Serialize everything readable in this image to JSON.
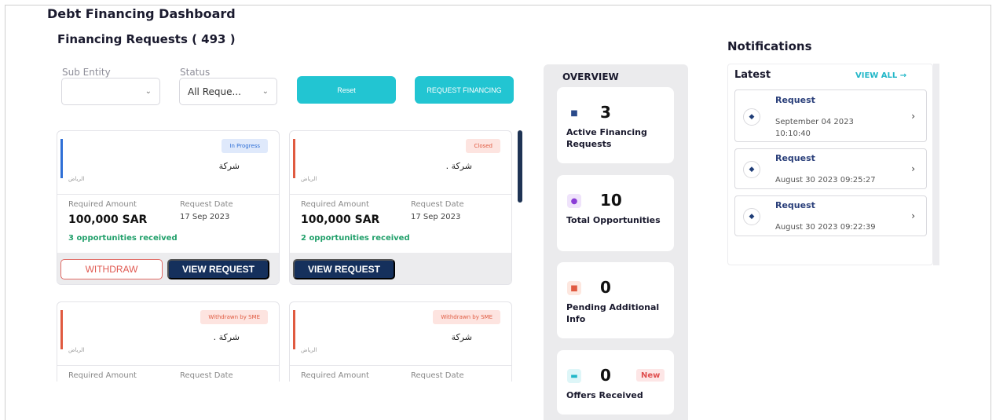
{
  "page_title": "Debt Financing Dashboard",
  "section_title": "Financing Requests ( 493 )",
  "filters": {
    "sub_entity_label": "Sub Entity",
    "sub_entity_value": "",
    "status_label": "Status",
    "status_value": "All Reque...",
    "reset_label": "Reset",
    "request_financing_label": "REQUEST FINANCING"
  },
  "common": {
    "required_amount_label": "Required Amount",
    "request_date_label": "Request Date",
    "withdraw_label": "WITHDRAW",
    "view_request_label": "VIEW REQUEST"
  },
  "cards": [
    {
      "status": "In Progress",
      "status_color": "#2f6fd6",
      "company": "شركة",
      "city": "الرياض",
      "amount": "100,000 SAR",
      "date": "17 Sep 2023",
      "opportunities": "3 opportunities received"
    },
    {
      "status": "Closed",
      "status_color": "#e05a40",
      "company": "شركة .",
      "city": "الرياض",
      "amount": "100,000 SAR",
      "date": "17 Sep 2023",
      "opportunities": "2 opportunities received"
    },
    {
      "status": "Withdrawn by SME",
      "status_color": "#e05a40",
      "company": "شركة .",
      "city": "الرياض"
    },
    {
      "status": "Withdrawn by SME",
      "status_color": "#e05a40",
      "company": "شركة",
      "city": "الرياض"
    }
  ],
  "overview": {
    "title": "OVERVIEW",
    "items": [
      {
        "value": "3",
        "label": "Active Financing Requests",
        "icon": "coins-icon"
      },
      {
        "value": "10",
        "label": "Total Opportunities",
        "icon": "lightbulb-icon"
      },
      {
        "value": "0",
        "label": "Pending Additional Info",
        "icon": "documents-icon"
      },
      {
        "value": "0",
        "label": "Offers Received",
        "icon": "card-icon",
        "badge": "New"
      }
    ]
  },
  "notifications": {
    "title": "Notifications",
    "latest_label": "Latest",
    "view_all_label": "VIEW ALL →",
    "items": [
      {
        "title": "Request",
        "time_line1": "September 04 2023",
        "time_line2": "10:10:40"
      },
      {
        "title": "Request",
        "time_line1": "August 30 2023 09:25:27"
      },
      {
        "title": "Request",
        "time_line1": "August 30 2023 09:22:39"
      }
    ]
  },
  "colors": {
    "accent_teal": "#22c5d2",
    "navy": "#15305c",
    "success_green": "#22a06b",
    "danger_red": "#e05a52"
  }
}
